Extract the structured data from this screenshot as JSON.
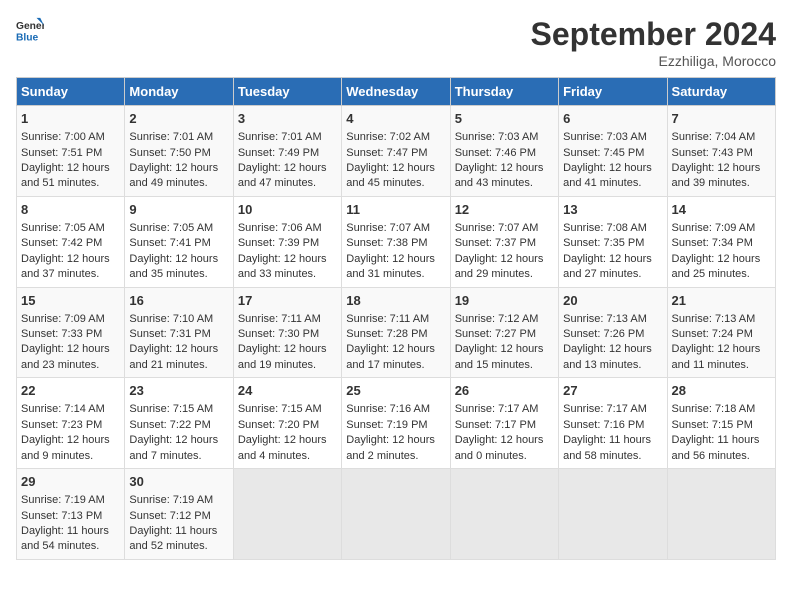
{
  "header": {
    "logo_line1": "General",
    "logo_line2": "Blue",
    "month": "September 2024",
    "location": "Ezzhiliga, Morocco"
  },
  "days_of_week": [
    "Sunday",
    "Monday",
    "Tuesday",
    "Wednesday",
    "Thursday",
    "Friday",
    "Saturday"
  ],
  "weeks": [
    {
      "cells": [
        {
          "day": "1",
          "info": "Sunrise: 7:00 AM\nSunset: 7:51 PM\nDaylight: 12 hours\nand 51 minutes."
        },
        {
          "day": "2",
          "info": "Sunrise: 7:01 AM\nSunset: 7:50 PM\nDaylight: 12 hours\nand 49 minutes."
        },
        {
          "day": "3",
          "info": "Sunrise: 7:01 AM\nSunset: 7:49 PM\nDaylight: 12 hours\nand 47 minutes."
        },
        {
          "day": "4",
          "info": "Sunrise: 7:02 AM\nSunset: 7:47 PM\nDaylight: 12 hours\nand 45 minutes."
        },
        {
          "day": "5",
          "info": "Sunrise: 7:03 AM\nSunset: 7:46 PM\nDaylight: 12 hours\nand 43 minutes."
        },
        {
          "day": "6",
          "info": "Sunrise: 7:03 AM\nSunset: 7:45 PM\nDaylight: 12 hours\nand 41 minutes."
        },
        {
          "day": "7",
          "info": "Sunrise: 7:04 AM\nSunset: 7:43 PM\nDaylight: 12 hours\nand 39 minutes."
        }
      ]
    },
    {
      "cells": [
        {
          "day": "8",
          "info": "Sunrise: 7:05 AM\nSunset: 7:42 PM\nDaylight: 12 hours\nand 37 minutes."
        },
        {
          "day": "9",
          "info": "Sunrise: 7:05 AM\nSunset: 7:41 PM\nDaylight: 12 hours\nand 35 minutes."
        },
        {
          "day": "10",
          "info": "Sunrise: 7:06 AM\nSunset: 7:39 PM\nDaylight: 12 hours\nand 33 minutes."
        },
        {
          "day": "11",
          "info": "Sunrise: 7:07 AM\nSunset: 7:38 PM\nDaylight: 12 hours\nand 31 minutes."
        },
        {
          "day": "12",
          "info": "Sunrise: 7:07 AM\nSunset: 7:37 PM\nDaylight: 12 hours\nand 29 minutes."
        },
        {
          "day": "13",
          "info": "Sunrise: 7:08 AM\nSunset: 7:35 PM\nDaylight: 12 hours\nand 27 minutes."
        },
        {
          "day": "14",
          "info": "Sunrise: 7:09 AM\nSunset: 7:34 PM\nDaylight: 12 hours\nand 25 minutes."
        }
      ]
    },
    {
      "cells": [
        {
          "day": "15",
          "info": "Sunrise: 7:09 AM\nSunset: 7:33 PM\nDaylight: 12 hours\nand 23 minutes."
        },
        {
          "day": "16",
          "info": "Sunrise: 7:10 AM\nSunset: 7:31 PM\nDaylight: 12 hours\nand 21 minutes."
        },
        {
          "day": "17",
          "info": "Sunrise: 7:11 AM\nSunset: 7:30 PM\nDaylight: 12 hours\nand 19 minutes."
        },
        {
          "day": "18",
          "info": "Sunrise: 7:11 AM\nSunset: 7:28 PM\nDaylight: 12 hours\nand 17 minutes."
        },
        {
          "day": "19",
          "info": "Sunrise: 7:12 AM\nSunset: 7:27 PM\nDaylight: 12 hours\nand 15 minutes."
        },
        {
          "day": "20",
          "info": "Sunrise: 7:13 AM\nSunset: 7:26 PM\nDaylight: 12 hours\nand 13 minutes."
        },
        {
          "day": "21",
          "info": "Sunrise: 7:13 AM\nSunset: 7:24 PM\nDaylight: 12 hours\nand 11 minutes."
        }
      ]
    },
    {
      "cells": [
        {
          "day": "22",
          "info": "Sunrise: 7:14 AM\nSunset: 7:23 PM\nDaylight: 12 hours\nand 9 minutes."
        },
        {
          "day": "23",
          "info": "Sunrise: 7:15 AM\nSunset: 7:22 PM\nDaylight: 12 hours\nand 7 minutes."
        },
        {
          "day": "24",
          "info": "Sunrise: 7:15 AM\nSunset: 7:20 PM\nDaylight: 12 hours\nand 4 minutes."
        },
        {
          "day": "25",
          "info": "Sunrise: 7:16 AM\nSunset: 7:19 PM\nDaylight: 12 hours\nand 2 minutes."
        },
        {
          "day": "26",
          "info": "Sunrise: 7:17 AM\nSunset: 7:17 PM\nDaylight: 12 hours\nand 0 minutes."
        },
        {
          "day": "27",
          "info": "Sunrise: 7:17 AM\nSunset: 7:16 PM\nDaylight: 11 hours\nand 58 minutes."
        },
        {
          "day": "28",
          "info": "Sunrise: 7:18 AM\nSunset: 7:15 PM\nDaylight: 11 hours\nand 56 minutes."
        }
      ]
    },
    {
      "cells": [
        {
          "day": "29",
          "info": "Sunrise: 7:19 AM\nSunset: 7:13 PM\nDaylight: 11 hours\nand 54 minutes."
        },
        {
          "day": "30",
          "info": "Sunrise: 7:19 AM\nSunset: 7:12 PM\nDaylight: 11 hours\nand 52 minutes."
        },
        {
          "day": "",
          "info": ""
        },
        {
          "day": "",
          "info": ""
        },
        {
          "day": "",
          "info": ""
        },
        {
          "day": "",
          "info": ""
        },
        {
          "day": "",
          "info": ""
        }
      ]
    }
  ]
}
